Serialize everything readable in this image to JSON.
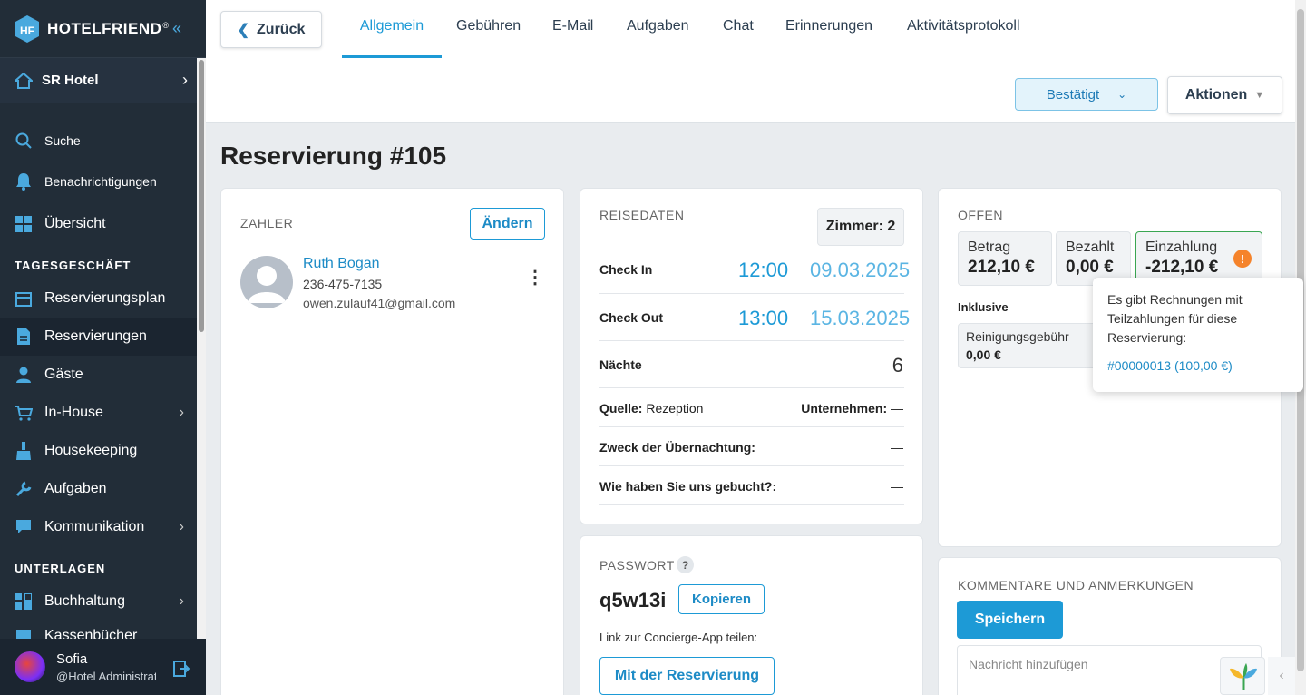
{
  "brand": {
    "name": "HOTELFRIEND",
    "reg": "®"
  },
  "sidebar": {
    "hotel": "SR Hotel",
    "items": [
      {
        "label": "Suche",
        "icon": "search-icon"
      },
      {
        "label": "Benachrichtigungen",
        "icon": "bell-icon"
      },
      {
        "label": "Übersicht",
        "icon": "dashboard-icon"
      }
    ],
    "section1": "TAGESGESCHÄFT",
    "ops": [
      {
        "label": "Reservierungsplan",
        "icon": "calendar-icon"
      },
      {
        "label": "Reservierungen",
        "icon": "document-icon"
      },
      {
        "label": "Gäste",
        "icon": "person-icon"
      },
      {
        "label": "In-House",
        "icon": "cart-icon"
      },
      {
        "label": "Housekeeping",
        "icon": "broom-icon"
      },
      {
        "label": "Aufgaben",
        "icon": "wrench-icon"
      },
      {
        "label": "Kommunikation",
        "icon": "chat-icon"
      }
    ],
    "section2": "UNTERLAGEN",
    "docs": [
      {
        "label": "Buchhaltung",
        "icon": "grid-icon"
      },
      {
        "label": "Kassenbücher",
        "icon": "book-icon"
      }
    ],
    "user": {
      "name": "Sofia",
      "role": "@Hotel Administrator"
    }
  },
  "topbar": {
    "back": "Zurück",
    "tabs": [
      "Allgemein",
      "Gebühren",
      "E-Mail",
      "Aufgaben",
      "Chat",
      "Erinnerungen",
      "Aktivitätsprotokoll"
    ],
    "status": "Bestätigt",
    "actions": "Aktionen"
  },
  "page": {
    "title": "Reservierung #105"
  },
  "payer": {
    "label": "ZAHLER",
    "change": "Ändern",
    "name": "Ruth Bogan",
    "phone": "236-475-7135",
    "email": "owen.zulauf41@gmail.com"
  },
  "trip": {
    "label": "REISEDATEN",
    "room": "Zimmer: 2",
    "checkin_label": "Check In",
    "checkin_time": "12:00",
    "checkin_date": "09.03.2025",
    "checkout_label": "Check Out",
    "checkout_time": "13:00",
    "checkout_date": "15.03.2025",
    "nights_label": "Nächte",
    "nights": "6",
    "source_label": "Quelle:",
    "source": "Rezeption",
    "company_label": "Unternehmen:",
    "company": "—",
    "purpose_label": "Zweck der Übernachtung:",
    "purpose": "—",
    "booked_label": "Wie haben Sie uns gebucht?:",
    "booked": "—"
  },
  "open": {
    "label": "OFFEN",
    "amount_label": "Betrag",
    "amount": "212,10 €",
    "paid_label": "Bezahlt",
    "paid": "0,00 €",
    "deposit_label": "Einzahlung",
    "deposit": "-212,10 €",
    "incl_label": "Inklusive",
    "fee_label": "Reinigungsgebühr",
    "fee": "0,00 €"
  },
  "tooltip": {
    "text": "Es gibt Rechnungen mit Teilzahlungen für diese Reservierung:",
    "link": "#00000013 (100,00 €)"
  },
  "password": {
    "label": "PASSWORT",
    "help": "?",
    "value": "q5w13i",
    "copy": "Kopieren",
    "share": "Link zur Concierge-App teilen:",
    "with_res": "Mit der Reservierung"
  },
  "comments": {
    "label": "KOMMENTARE UND ANMERKUNGEN",
    "save": "Speichern",
    "placeholder": "Nachricht hinzufügen"
  },
  "colors": {
    "accent": "#1d9ad6",
    "sidebar": "#222d38",
    "warning": "#f5832b"
  }
}
